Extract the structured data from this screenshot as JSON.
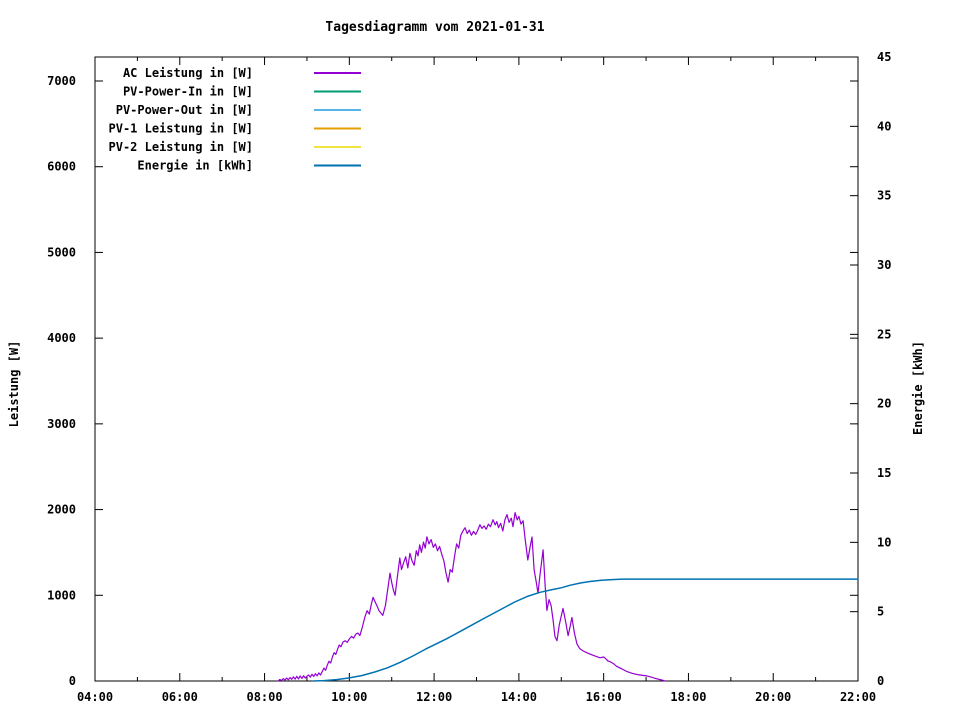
{
  "chart_data": {
    "type": "line",
    "title": "Tagesdiagramm vom 2021-01-31",
    "x_axis": {
      "tick_labels": [
        "04:00",
        "06:00",
        "08:00",
        "10:00",
        "12:00",
        "14:00",
        "16:00",
        "18:00",
        "20:00",
        "22:00"
      ],
      "range_hours": [
        4,
        22
      ],
      "major_step_hours": 2,
      "minor_step_hours": 1
    },
    "y_left": {
      "label": "Leistung [W]",
      "ticks": [
        0,
        1000,
        2000,
        3000,
        4000,
        5000,
        6000,
        7000
      ],
      "range": [
        0,
        7280
      ]
    },
    "y_right": {
      "label": "Energie [kWh]",
      "ticks": [
        0,
        5,
        10,
        15,
        20,
        25,
        30,
        35,
        40,
        45
      ],
      "range": [
        0,
        45
      ]
    },
    "grid": "off",
    "legend_position": "top-left-inside",
    "series": [
      {
        "name": "AC Leistung in [W]",
        "color": "#9400d3",
        "axis": "left",
        "points": [
          [
            8.32,
            0
          ],
          [
            8.36,
            18
          ],
          [
            8.4,
            6
          ],
          [
            8.44,
            28
          ],
          [
            8.48,
            10
          ],
          [
            8.52,
            35
          ],
          [
            8.56,
            14
          ],
          [
            8.6,
            40
          ],
          [
            8.64,
            20
          ],
          [
            8.68,
            48
          ],
          [
            8.72,
            22
          ],
          [
            8.76,
            55
          ],
          [
            8.8,
            25
          ],
          [
            8.84,
            60
          ],
          [
            8.88,
            30
          ],
          [
            8.92,
            62
          ],
          [
            8.96,
            35
          ],
          [
            9.0,
            55
          ],
          [
            9.04,
            70
          ],
          [
            9.08,
            45
          ],
          [
            9.12,
            78
          ],
          [
            9.16,
            52
          ],
          [
            9.2,
            85
          ],
          [
            9.24,
            60
          ],
          [
            9.28,
            95
          ],
          [
            9.32,
            70
          ],
          [
            9.36,
            110
          ],
          [
            9.4,
            150
          ],
          [
            9.44,
            125
          ],
          [
            9.48,
            185
          ],
          [
            9.52,
            230
          ],
          [
            9.56,
            210
          ],
          [
            9.6,
            280
          ],
          [
            9.64,
            330
          ],
          [
            9.68,
            310
          ],
          [
            9.72,
            370
          ],
          [
            9.76,
            420
          ],
          [
            9.8,
            400
          ],
          [
            9.85,
            455
          ],
          [
            9.9,
            470
          ],
          [
            9.95,
            450
          ],
          [
            10.0,
            490
          ],
          [
            10.05,
            520
          ],
          [
            10.1,
            500
          ],
          [
            10.15,
            545
          ],
          [
            10.2,
            560
          ],
          [
            10.25,
            530
          ],
          [
            10.3,
            620
          ],
          [
            10.37,
            750
          ],
          [
            10.42,
            820
          ],
          [
            10.47,
            780
          ],
          [
            10.52,
            900
          ],
          [
            10.56,
            976
          ],
          [
            10.6,
            930
          ],
          [
            10.65,
            880
          ],
          [
            10.7,
            820
          ],
          [
            10.75,
            790
          ],
          [
            10.79,
            765
          ],
          [
            10.85,
            880
          ],
          [
            10.9,
            1050
          ],
          [
            10.96,
            1259
          ],
          [
            11.0,
            1150
          ],
          [
            11.04,
            1060
          ],
          [
            11.08,
            1000
          ],
          [
            11.13,
            1200
          ],
          [
            11.19,
            1435
          ],
          [
            11.23,
            1300
          ],
          [
            11.28,
            1380
          ],
          [
            11.33,
            1450
          ],
          [
            11.38,
            1320
          ],
          [
            11.43,
            1490
          ],
          [
            11.48,
            1400
          ],
          [
            11.53,
            1350
          ],
          [
            11.58,
            1520
          ],
          [
            11.62,
            1460
          ],
          [
            11.66,
            1588
          ],
          [
            11.7,
            1500
          ],
          [
            11.75,
            1620
          ],
          [
            11.79,
            1550
          ],
          [
            11.83,
            1682
          ],
          [
            11.88,
            1600
          ],
          [
            11.93,
            1650
          ],
          [
            11.98,
            1560
          ],
          [
            12.03,
            1600
          ],
          [
            12.08,
            1520
          ],
          [
            12.13,
            1570
          ],
          [
            12.18,
            1480
          ],
          [
            12.23,
            1400
          ],
          [
            12.28,
            1260
          ],
          [
            12.33,
            1153
          ],
          [
            12.38,
            1300
          ],
          [
            12.43,
            1270
          ],
          [
            12.48,
            1450
          ],
          [
            12.53,
            1600
          ],
          [
            12.58,
            1550
          ],
          [
            12.63,
            1700
          ],
          [
            12.68,
            1750
          ],
          [
            12.73,
            1788
          ],
          [
            12.78,
            1720
          ],
          [
            12.83,
            1760
          ],
          [
            12.88,
            1700
          ],
          [
            12.93,
            1745
          ],
          [
            12.98,
            1710
          ],
          [
            13.03,
            1760
          ],
          [
            13.08,
            1824
          ],
          [
            13.13,
            1780
          ],
          [
            13.18,
            1810
          ],
          [
            13.23,
            1770
          ],
          [
            13.28,
            1830
          ],
          [
            13.33,
            1800
          ],
          [
            13.39,
            1882
          ],
          [
            13.44,
            1820
          ],
          [
            13.48,
            1860
          ],
          [
            13.52,
            1790
          ],
          [
            13.57,
            1840
          ],
          [
            13.62,
            1750
          ],
          [
            13.67,
            1880
          ],
          [
            13.72,
            1941
          ],
          [
            13.77,
            1850
          ],
          [
            13.82,
            1900
          ],
          [
            13.86,
            1800
          ],
          [
            13.91,
            1965
          ],
          [
            13.96,
            1880
          ],
          [
            14.0,
            1920
          ],
          [
            14.05,
            1830
          ],
          [
            14.1,
            1870
          ],
          [
            14.15,
            1650
          ],
          [
            14.21,
            1412
          ],
          [
            14.26,
            1550
          ],
          [
            14.31,
            1680
          ],
          [
            14.36,
            1300
          ],
          [
            14.41,
            1150
          ],
          [
            14.45,
            1024
          ],
          [
            14.5,
            1250
          ],
          [
            14.57,
            1529
          ],
          [
            14.62,
            1100
          ],
          [
            14.66,
            824
          ],
          [
            14.71,
            950
          ],
          [
            14.76,
            880
          ],
          [
            14.81,
            700
          ],
          [
            14.85,
            520
          ],
          [
            14.9,
            470
          ],
          [
            14.95,
            650
          ],
          [
            15.04,
            847
          ],
          [
            15.1,
            700
          ],
          [
            15.16,
            529
          ],
          [
            15.21,
            640
          ],
          [
            15.25,
            741
          ],
          [
            15.31,
            560
          ],
          [
            15.37,
            430
          ],
          [
            15.44,
            376
          ],
          [
            15.52,
            350
          ],
          [
            15.6,
            330
          ],
          [
            15.7,
            310
          ],
          [
            15.8,
            290
          ],
          [
            15.91,
            271
          ],
          [
            16.0,
            280
          ],
          [
            16.05,
            260
          ],
          [
            16.1,
            235
          ],
          [
            16.17,
            220
          ],
          [
            16.24,
            200
          ],
          [
            16.31,
            170
          ],
          [
            16.43,
            141
          ],
          [
            16.55,
            110
          ],
          [
            16.67,
            90
          ],
          [
            16.8,
            75
          ],
          [
            16.92,
            65
          ],
          [
            17.02,
            59
          ],
          [
            17.12,
            45
          ],
          [
            17.22,
            30
          ],
          [
            17.32,
            18
          ],
          [
            17.4,
            8
          ],
          [
            17.45,
            0
          ]
        ]
      },
      {
        "name": "PV-Power-In in [W]",
        "color": "#009e73",
        "axis": "left",
        "points": []
      },
      {
        "name": "PV-Power-Out in [W]",
        "color": "#56b4e9",
        "axis": "left",
        "points": []
      },
      {
        "name": "PV-1 Leistung in [W]",
        "color": "#e69f00",
        "axis": "left",
        "points": []
      },
      {
        "name": "PV-2 Leistung in [W]",
        "color": "#f0e442",
        "axis": "left",
        "points": []
      },
      {
        "name": "Energie in [kWh]",
        "color": "#0072b2",
        "axis": "right",
        "points": [
          [
            9.15,
            0
          ],
          [
            9.4,
            0.03
          ],
          [
            9.7,
            0.1
          ],
          [
            10.0,
            0.22
          ],
          [
            10.3,
            0.4
          ],
          [
            10.6,
            0.65
          ],
          [
            10.9,
            0.95
          ],
          [
            11.2,
            1.35
          ],
          [
            11.5,
            1.8
          ],
          [
            11.8,
            2.3
          ],
          [
            12.0,
            2.6
          ],
          [
            12.3,
            3.05
          ],
          [
            12.6,
            3.55
          ],
          [
            12.9,
            4.05
          ],
          [
            13.2,
            4.55
          ],
          [
            13.55,
            5.12
          ],
          [
            13.9,
            5.7
          ],
          [
            14.2,
            6.1
          ],
          [
            14.5,
            6.4
          ],
          [
            14.8,
            6.6
          ],
          [
            15.0,
            6.72
          ],
          [
            15.2,
            6.9
          ],
          [
            15.45,
            7.07
          ],
          [
            15.7,
            7.18
          ],
          [
            15.95,
            7.26
          ],
          [
            16.2,
            7.31
          ],
          [
            16.45,
            7.35
          ],
          [
            22.0,
            7.35
          ]
        ]
      }
    ]
  }
}
